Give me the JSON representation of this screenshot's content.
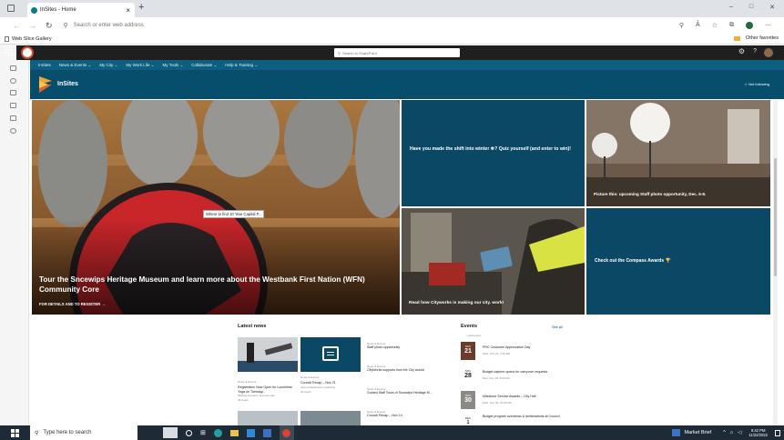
{
  "browser": {
    "tab_title": "InSites - Home",
    "tab_close": "×",
    "new_tab": "+",
    "address_placeholder": "Search or enter web address",
    "favorite_bookmark": "Web Slice Gallery",
    "other_favorites": "Other favorites"
  },
  "suite_bar": {
    "search_placeholder": "Search in SharePoint"
  },
  "site_nav": {
    "items": [
      "InSites",
      "News & Events ⌄",
      "My City ⌄",
      "My Work Life ⌄",
      "My Tools ⌄",
      "Collaborate ⌄",
      "Help & Training ⌄"
    ]
  },
  "site_header": {
    "title": "InSites",
    "follow": "☆ Not following"
  },
  "hero": {
    "main_title": "Tour the Sncewips Heritage Museum and learn more about the Westbank First Nation (WFN) Community Core",
    "main_link": "FOR DETAILS AND TO REGISTER →",
    "tooltip": "Where to find 10 Year Capital P...",
    "tile_winter": "Have you made the shift into winter ❄? Quiz yourself (and enter to win)!",
    "tile_photo": "Picture this: upcoming Staff photo opportunity, Dec. 6-8.",
    "tile_cityworks": "Read how Cityworks is making our city. work!",
    "tile_compass": "Check out the Compass Awards 🏆"
  },
  "news": {
    "heading": "Latest news",
    "cards": [
      {
        "category": "News & Events",
        "title": "Registration Now Open for Lunchtime Yoga on Tuesday...",
        "author": "Melissa Lemieux",
        "time": "12 hours ago",
        "meta": "46 views"
      },
      {
        "category": "News & Events",
        "title": "Council Recap – Nov 21",
        "author": "Aimee Mackintosh",
        "time": "yesterday",
        "meta": "26 views"
      }
    ],
    "list": [
      {
        "category": "News & Events",
        "title": "Staff photo opportunity"
      },
      {
        "category": "News & Events",
        "title": "CityWorks supports how the City works!"
      },
      {
        "category": "News & Events",
        "title": "Guided Staff Tours of Sncewips Heritage M..."
      },
      {
        "category": "News & Events",
        "title": "Council Recap – Nov 14"
      }
    ]
  },
  "events": {
    "heading": "Events",
    "see_all": "See all",
    "add_event": "+ Add event",
    "items": [
      {
        "month": "NOV",
        "day": "21",
        "title": "PRC Customer Appreciation Day",
        "time": "Wed, Nov 23, 7:00 AM"
      },
      {
        "month": "NOV",
        "day": "28",
        "title": "Budget capture opens for carryover requests",
        "time": "Mon, Nov 28, 8:00 AM"
      },
      {
        "month": "NOV",
        "day": "30",
        "title": "Milestone Service Awards – City Hall",
        "time": "Wed, Nov 30, 10:30 AM"
      },
      {
        "month": "DEC",
        "day": "1",
        "title": "Budget program overviews & deliberations at Council",
        "time": ""
      }
    ]
  },
  "taskbar": {
    "search_placeholder": "Type here to search",
    "market": "Market Brief",
    "time": "9:42 PM",
    "date": "11/22/2022"
  },
  "colors": {
    "site_nav": "#0d5f7f",
    "site_header": "#064e6c",
    "tile_dark_blue": "#0a4866",
    "taskbar": "#1e2a36"
  }
}
